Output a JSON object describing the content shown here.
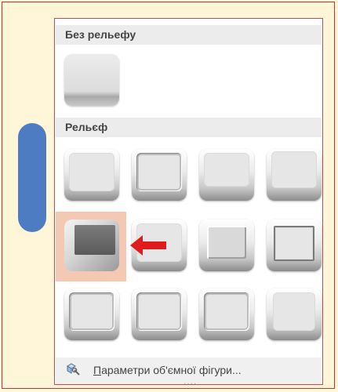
{
  "panel": {
    "section_no_bevel": "Без рельефу",
    "section_bevel": "Рельєф",
    "footer_link": "Параметри об'ємної фігури...",
    "footer_link_underlined_letter": "П",
    "footer_link_rest": "араметри об'ємної фігури...",
    "selected_index": 4
  },
  "icons": {
    "footer": "cube-3d-settings-icon",
    "arrow": "red-left-arrow-icon"
  },
  "colors": {
    "background": "#fff6d9",
    "frame_border": "#b23a3a",
    "slider": "#4e7cc2",
    "selection": "#f3c9b4",
    "arrow": "#e01b1b"
  }
}
